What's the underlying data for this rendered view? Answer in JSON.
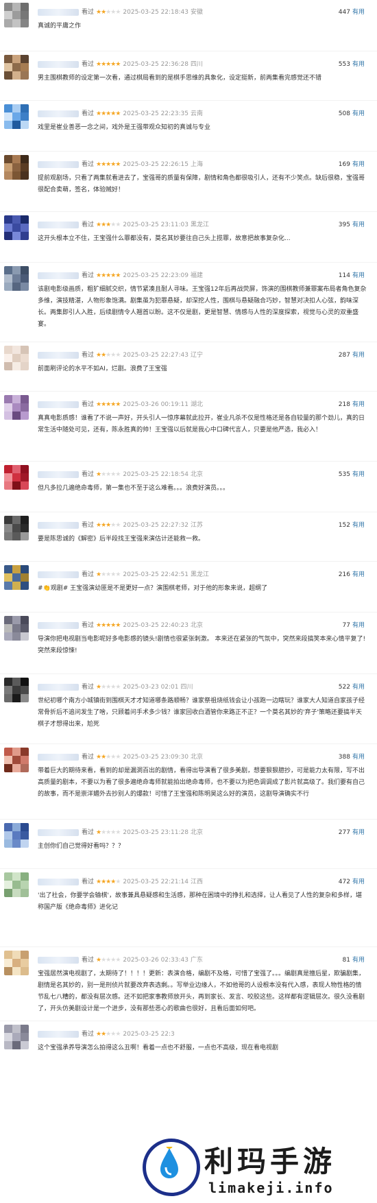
{
  "watched_label": "看过",
  "useful_label": "有用",
  "star_color": "#f5a623",
  "link_color": "#3377aa",
  "comments": [
    {
      "stars": 2,
      "time": "2025-03-25 22:18:43",
      "location": "安徽",
      "votes": "447",
      "text": "真诚的平庸之作"
    },
    {
      "stars": 5,
      "time": "2025-03-25 22:36:28",
      "location": "四川",
      "votes": "553",
      "text": "男主围棋教师的设定第一次看，通过棋局看到的是棋手思维的具象化，设定挺新，前两集看完感觉还不错"
    },
    {
      "stars": 5,
      "time": "2025-03-25 22:23:35",
      "location": "云南",
      "votes": "508",
      "text": "戏里是崔业善恶一念之间，戏外是王强带观众知初的真诚与专业"
    },
    {
      "stars": 5,
      "time": "2025-03-25 22:26:15",
      "location": "上海",
      "votes": "169",
      "text": "提前观剧场，只看了两集就看进去了，宝强哥的质量有保障，剧情和角色都很吸引人，还有不少笑点。缺后很稳，宝强哥很配合卖萌，签名，体验贼好！"
    },
    {
      "stars": 3,
      "time": "2025-03-25 23:11:03",
      "location": "黑龙江",
      "votes": "395",
      "text": "这开头根本立不住，王宝强什么罪都没有，莫名其妙要往自己头上揽罪，故意把故事复杂化..."
    },
    {
      "stars": 5,
      "time": "2025-03-25 22:23:09",
      "location": "福建",
      "votes": "114",
      "text": "该剧电影级画质，粗犷细腻交织，情节紧凑且耐人寻味。王宝强12年后再战荧屏，饰演的围棋教师兼罪案布局者角色复杂多维，演技精湛，人物形象饱满。剧集虽为犯罪悬疑，却深挖人性，围棋与悬疑融合巧妙，智慧对决扣人心弦，韵味深长。两集即引人入胜，后续剧情令人翘首以盼。这不仅是剧，更是智慧、情感与人性的深度探索，视觉与心灵的双重盛宴。"
    },
    {
      "stars": 2,
      "time": "2025-03-25 22:27:43",
      "location": "辽宁",
      "votes": "287",
      "text": "前面刷评论的水平不如AI，烂剧。浪费了王宝强"
    },
    {
      "stars": 5,
      "time": "2025-03-26 00:19:11",
      "location": "湖北",
      "votes": "218",
      "text": "真真电影质感！谁看了不说一声好，开头引人一惊序幕就此拉开，崔业凡杀不仅是性格还是各自较量的那个劲儿，真的日常生活中随处可见，还有，陈永胜真的帅！王宝强以后就是我心中口碑代言人，只要是他严选，我必入！"
    },
    {
      "stars": 1,
      "time": "2025-03-25 22:18:54",
      "location": "北京",
      "votes": "535",
      "text": "但凡多拉几遍绝命毒师，第一集也不至于这么难看。。。浪费好演员。。。"
    },
    {
      "stars": 3,
      "time": "2025-03-25 22:27:32",
      "location": "江苏",
      "votes": "152",
      "text": "要是陈思诚的《解密》后半段找王宝强来演估计还能救一救。"
    },
    {
      "stars": 1,
      "time": "2025-03-25 22:42:51",
      "location": "黑龙江",
      "votes": "216",
      "text": "#👏观剧# 王宝强演幼匪是不是更好一点？演围棋老师，对于他的形象来说，超纲了"
    },
    {
      "stars": 5,
      "time": "2025-03-25 22:40:23",
      "location": "北京",
      "votes": "77",
      "text": "导演你把电视剧当电影呢好多电影感的镜头!剧情也很紧张刺激。 本来还在紧张的气氛中，突然来段搞笑本来心情平复了!突然来段惊悚!"
    },
    {
      "stars": 1,
      "time": "2025-03-23 02:01",
      "location": "四川",
      "votes": "522",
      "text": "世纪初哪个南方小城镇街到围棋天才才知道哪条路顺畅？谁家祭祖烧纸钱会让小孩跑一边瞎玩？谁家大人知道自家孩子经常骨折后不追问发生了啥，只顾着问手术多少钱？谁家回收白酒管你来路正不正？一个莫名其妙的'弃子'策略还要搞半天棋子才想得出来，尬死"
    },
    {
      "stars": 2,
      "time": "2025-03-25 23:09:30",
      "location": "北京",
      "votes": "388",
      "text": "带着巨大的期待来看，看到的却是漏洞百出的剧情，看得出导演看了很多美剧，想要狠狠臆抄，可是能力太有限，写不出高质量的剧本，不要以为看了很多遍绝命毒师就能拍出绝命毒师，也不要以为把色调调成了影片就高级了。我们要有自己的故事，而不是崇洋媚外去抄别人的爆款！可惜了王宝强和陈明昊这么好的演员，这剧导演确实不行"
    },
    {
      "stars": 1,
      "time": "2025-03-25 23:11:28",
      "location": "北京",
      "votes": "277",
      "text": "主创你们自己觉得好看吗？？？"
    },
    {
      "stars": 4,
      "time": "2025-03-25 22:21:14",
      "location": "江西",
      "votes": "472",
      "text": "'出了社会，你要学会输棋'，故事兼具悬疑感和生活感，那种在困境中的挣扎和选择，让人看见了人性的复杂和多样，堪称国产版《绝命毒师》进化记"
    },
    {
      "stars": 1,
      "time": "2025-03-26 02:33:43",
      "location": "广东",
      "votes": "81",
      "text": "宝强居然演电视剧了，太期待了！！！！更新：表演合格，编剧不及格，可惜了宝强了。。。编剧真是擅后星，欺骗剧集，剧情是名其妙的，别一是刑侦片就要改弃表选剩。。写举业边缘人，不如他哥的人设根本没有代入感，表现人物性格的情节乱七八糟的，都没有层次感。还不如把家事教师放开头，再到家长、发言、咬胶这些。这样都有逻辑层次。很久没看剧了，开头仿美剧设计是一个进步，没有那些恶心的歌曲也很好，且看后面如何吧。"
    },
    {
      "stars": 2,
      "time": "2025-03-25 22:3",
      "location": "",
      "votes": "",
      "text": "这个宝强承养导演怎么拍得这么丑啊！看着一点也不舒服，一点也不高级，现在看电视剧"
    }
  ],
  "watermark": {
    "title": "利玛手游",
    "subtitle": "limakeji.info"
  }
}
